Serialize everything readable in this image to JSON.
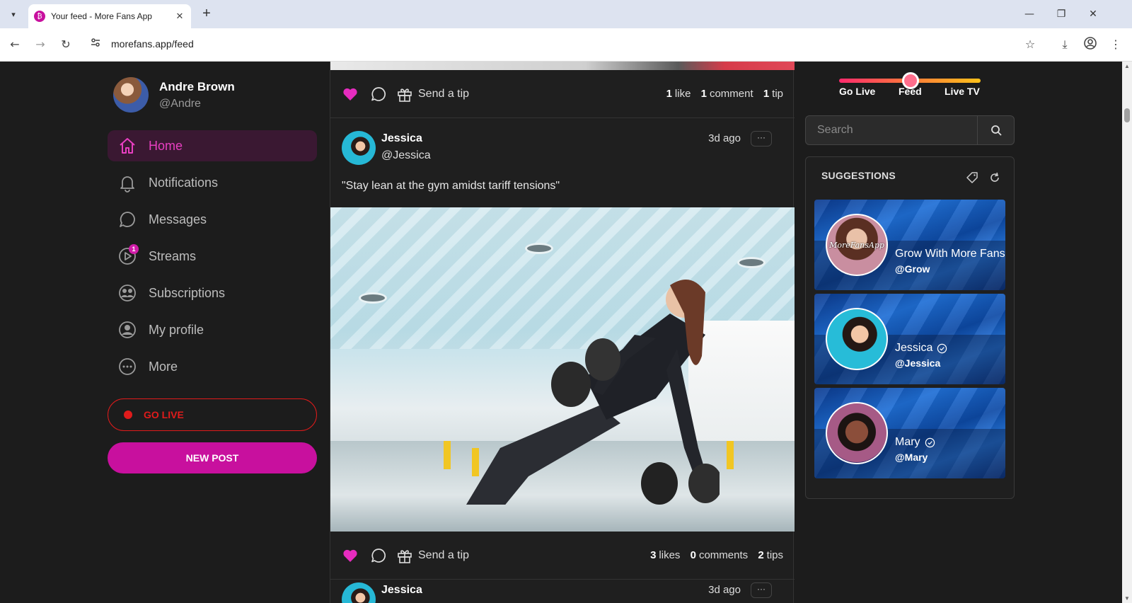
{
  "browser": {
    "tab_title": "Your feed - More Fans App",
    "url": "morefans.app/feed",
    "favicon_glyph": "₿"
  },
  "user": {
    "name": "Andre Brown",
    "handle": "@Andre"
  },
  "nav": {
    "items": [
      {
        "label": "Home",
        "icon": "home-icon",
        "active": true
      },
      {
        "label": "Notifications",
        "icon": "bell-icon"
      },
      {
        "label": "Messages",
        "icon": "chat-icon"
      },
      {
        "label": "Streams",
        "icon": "play-icon",
        "badge": "1"
      },
      {
        "label": "Subscriptions",
        "icon": "users-icon"
      },
      {
        "label": "My profile",
        "icon": "user-icon"
      },
      {
        "label": "More",
        "icon": "more-icon"
      }
    ],
    "go_live": "GO LIVE",
    "new_post": "NEW POST"
  },
  "feed": {
    "top_post": {
      "tip_label": "Send a tip",
      "likes": "1",
      "likes_label": "like",
      "comments": "1",
      "comments_label": "comment",
      "tips": "1",
      "tips_label": "tip"
    },
    "post": {
      "author": "Jessica",
      "handle": "@Jessica",
      "time": "3d ago",
      "text": "\"Stay lean at the gym amidst tariff tensions\"",
      "more": "···",
      "tip_label": "Send a tip",
      "likes": "3",
      "likes_label": "likes",
      "comments": "0",
      "comments_label": "comments",
      "tips": "2",
      "tips_label": "tips"
    },
    "next_post": {
      "author": "Jessica",
      "time": "3d ago",
      "more": "···"
    }
  },
  "mode_toggle": {
    "options": [
      "Go Live",
      "Feed",
      "Live TV"
    ],
    "selected": "Feed"
  },
  "search": {
    "placeholder": "Search"
  },
  "suggestions": {
    "title": "SUGGESTIONS",
    "items": [
      {
        "name": "Grow With More Fans",
        "handle": "@Grow",
        "verified": false,
        "avatar_text": "MoreFansApp"
      },
      {
        "name": "Jessica",
        "handle": "@Jessica",
        "verified": true
      },
      {
        "name": "Mary",
        "handle": "@Mary",
        "verified": true
      }
    ]
  },
  "colors": {
    "accent": "#c8109e",
    "active_nav_text": "#e83fc1",
    "live": "#e01b1b",
    "heart": "#e62cbf"
  }
}
